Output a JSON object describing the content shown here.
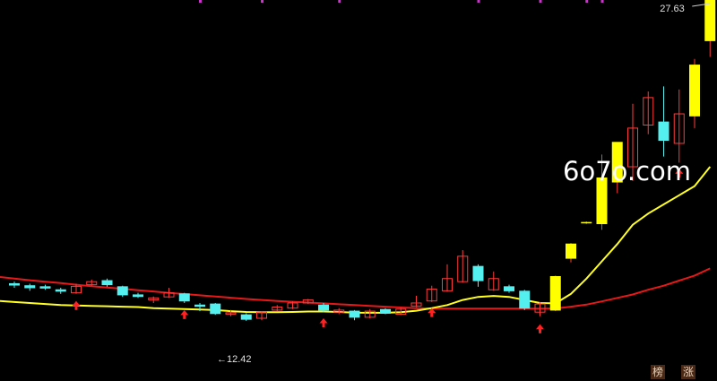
{
  "watermark": "6o7o.com",
  "badges": [
    "榜",
    "涨"
  ],
  "colors": {
    "background": "#000000",
    "up_hollow": "#ff3b3b",
    "down_solid": "#54f0f0",
    "strong_up": "#ffff00",
    "ma_short": "#ffff20",
    "ma_long": "#e81818",
    "arrow": "#ff2222",
    "top_marks": "#cc33cc"
  },
  "chart_data": {
    "type": "candlestick",
    "title": "",
    "xlabel": "",
    "ylabel": "",
    "ylim": [
      11.36,
      28.2
    ],
    "price_labels": {
      "high": "27.63",
      "low": "12.42"
    },
    "candles": [
      {
        "o": 14.25,
        "c": 14.18,
        "h": 14.35,
        "l": 14.05,
        "s": "down"
      },
      {
        "o": 14.15,
        "c": 14.05,
        "h": 14.25,
        "l": 13.9,
        "s": "down"
      },
      {
        "o": 14.1,
        "c": 14.05,
        "h": 14.2,
        "l": 13.95,
        "s": "down"
      },
      {
        "o": 13.95,
        "c": 13.88,
        "h": 14.05,
        "l": 13.75,
        "s": "down"
      },
      {
        "o": 13.8,
        "c": 14.12,
        "h": 14.25,
        "l": 13.75,
        "s": "up"
      },
      {
        "o": 14.2,
        "c": 14.35,
        "h": 14.45,
        "l": 14.15,
        "s": "up"
      },
      {
        "o": 14.4,
        "c": 14.2,
        "h": 14.5,
        "l": 14.1,
        "s": "down"
      },
      {
        "o": 14.1,
        "c": 13.7,
        "h": 14.15,
        "l": 13.6,
        "s": "down"
      },
      {
        "o": 13.7,
        "c": 13.62,
        "h": 13.8,
        "l": 13.55,
        "s": "down"
      },
      {
        "o": 13.45,
        "c": 13.55,
        "h": 13.62,
        "l": 13.3,
        "s": "up"
      },
      {
        "o": 13.6,
        "c": 13.8,
        "h": 14.05,
        "l": 13.55,
        "s": "up"
      },
      {
        "o": 13.75,
        "c": 13.4,
        "h": 13.8,
        "l": 13.3,
        "s": "down"
      },
      {
        "o": 13.2,
        "c": 13.15,
        "h": 13.3,
        "l": 12.9,
        "s": "down"
      },
      {
        "o": 13.25,
        "c": 12.78,
        "h": 13.3,
        "l": 12.72,
        "s": "down"
      },
      {
        "o": 12.8,
        "c": 12.82,
        "h": 12.96,
        "l": 12.65,
        "s": "up"
      },
      {
        "o": 12.72,
        "c": 12.5,
        "h": 12.8,
        "l": 12.42,
        "s": "down"
      },
      {
        "o": 12.55,
        "c": 12.85,
        "h": 12.9,
        "l": 12.45,
        "s": "up"
      },
      {
        "o": 12.95,
        "c": 13.1,
        "h": 13.2,
        "l": 12.9,
        "s": "up"
      },
      {
        "o": 13.05,
        "c": 13.3,
        "h": 13.38,
        "l": 13.0,
        "s": "up"
      },
      {
        "o": 13.3,
        "c": 13.45,
        "h": 13.5,
        "l": 13.25,
        "s": "up"
      },
      {
        "o": 13.2,
        "c": 12.95,
        "h": 13.3,
        "l": 12.85,
        "s": "down"
      },
      {
        "o": 12.85,
        "c": 12.95,
        "h": 13.05,
        "l": 12.75,
        "s": "up"
      },
      {
        "o": 12.9,
        "c": 12.6,
        "h": 12.95,
        "l": 12.45,
        "s": "down"
      },
      {
        "o": 12.6,
        "c": 12.9,
        "h": 13.0,
        "l": 12.55,
        "s": "up"
      },
      {
        "o": 12.8,
        "c": 12.98,
        "h": 13.05,
        "l": 12.75,
        "s": "down"
      },
      {
        "o": 12.75,
        "c": 13.0,
        "h": 13.05,
        "l": 12.7,
        "s": "up"
      },
      {
        "o": 13.15,
        "c": 13.3,
        "h": 13.65,
        "l": 13.1,
        "s": "up"
      },
      {
        "o": 13.4,
        "c": 13.98,
        "h": 14.15,
        "l": 13.35,
        "s": "up"
      },
      {
        "o": 13.9,
        "c": 14.5,
        "h": 15.2,
        "l": 13.85,
        "s": "up"
      },
      {
        "o": 14.35,
        "c": 15.6,
        "h": 15.9,
        "l": 14.3,
        "s": "up"
      },
      {
        "o": 15.1,
        "c": 14.4,
        "h": 15.2,
        "l": 14.1,
        "s": "down"
      },
      {
        "o": 13.95,
        "c": 14.5,
        "h": 14.85,
        "l": 13.9,
        "s": "up"
      },
      {
        "o": 14.1,
        "c": 13.9,
        "h": 14.2,
        "l": 13.8,
        "s": "down"
      },
      {
        "o": 13.88,
        "c": 13.05,
        "h": 13.95,
        "l": 12.95,
        "s": "down"
      },
      {
        "o": 12.85,
        "c": 13.25,
        "h": 13.35,
        "l": 12.65,
        "s": "up"
      },
      {
        "o": 12.95,
        "c": 14.6,
        "h": 14.65,
        "l": 12.9,
        "s": "strong"
      },
      {
        "o": 15.5,
        "c": 16.2,
        "h": 16.25,
        "l": 15.3,
        "s": "strong"
      },
      {
        "o": 17.25,
        "c": 17.25,
        "h": 17.3,
        "l": 17.2,
        "s": "flat"
      },
      {
        "o": 17.2,
        "c": 19.45,
        "h": 20.6,
        "l": 16.9,
        "s": "strong"
      },
      {
        "o": 19.25,
        "c": 21.2,
        "h": 21.2,
        "l": 18.7,
        "s": "strong"
      },
      {
        "o": 20.0,
        "c": 21.9,
        "h": 23.1,
        "l": 19.3,
        "s": "up"
      },
      {
        "o": 22.05,
        "c": 23.4,
        "h": 23.7,
        "l": 21.6,
        "s": "up"
      },
      {
        "o": 22.2,
        "c": 21.3,
        "h": 23.95,
        "l": 20.5,
        "s": "down"
      },
      {
        "o": 21.15,
        "c": 22.6,
        "h": 23.8,
        "l": 20.2,
        "s": "up"
      },
      {
        "o": 22.5,
        "c": 25.0,
        "h": 25.3,
        "l": 21.9,
        "s": "strong"
      },
      {
        "o": 26.2,
        "c": 28.2,
        "h": 28.2,
        "l": 25.4,
        "s": "strong"
      }
    ],
    "ma_short": [
      13.35,
      13.3,
      13.25,
      13.2,
      13.18,
      13.16,
      13.14,
      13.12,
      13.1,
      13.05,
      13.02,
      13.0,
      12.98,
      12.95,
      12.9,
      12.86,
      12.85,
      12.85,
      12.86,
      12.88,
      12.88,
      12.86,
      12.83,
      12.82,
      12.82,
      12.85,
      12.92,
      13.05,
      13.2,
      13.45,
      13.6,
      13.65,
      13.6,
      13.45,
      13.3,
      13.28,
      13.75,
      14.5,
      15.35,
      16.2,
      17.15,
      17.7,
      18.15,
      18.6,
      19.05,
      20.0
    ],
    "ma_long": [
      14.5,
      14.42,
      14.35,
      14.28,
      14.2,
      14.13,
      14.06,
      14.0,
      13.93,
      13.87,
      13.8,
      13.74,
      13.68,
      13.62,
      13.56,
      13.5,
      13.45,
      13.4,
      13.36,
      13.32,
      13.28,
      13.24,
      13.2,
      13.16,
      13.12,
      13.08,
      13.05,
      13.03,
      13.02,
      13.02,
      13.02,
      13.02,
      13.02,
      13.02,
      13.02,
      13.03,
      13.12,
      13.22,
      13.38,
      13.55,
      13.72,
      13.95,
      14.15,
      14.4,
      14.65,
      15.0
    ],
    "signal_arrows": [
      4,
      11,
      20,
      27,
      34,
      43
    ],
    "arrow_drop": [
      0.35,
      0.35,
      0.3,
      0.3,
      0.4,
      0.3
    ],
    "top_marks": [
      12,
      16,
      21,
      30,
      34,
      37,
      38
    ]
  }
}
